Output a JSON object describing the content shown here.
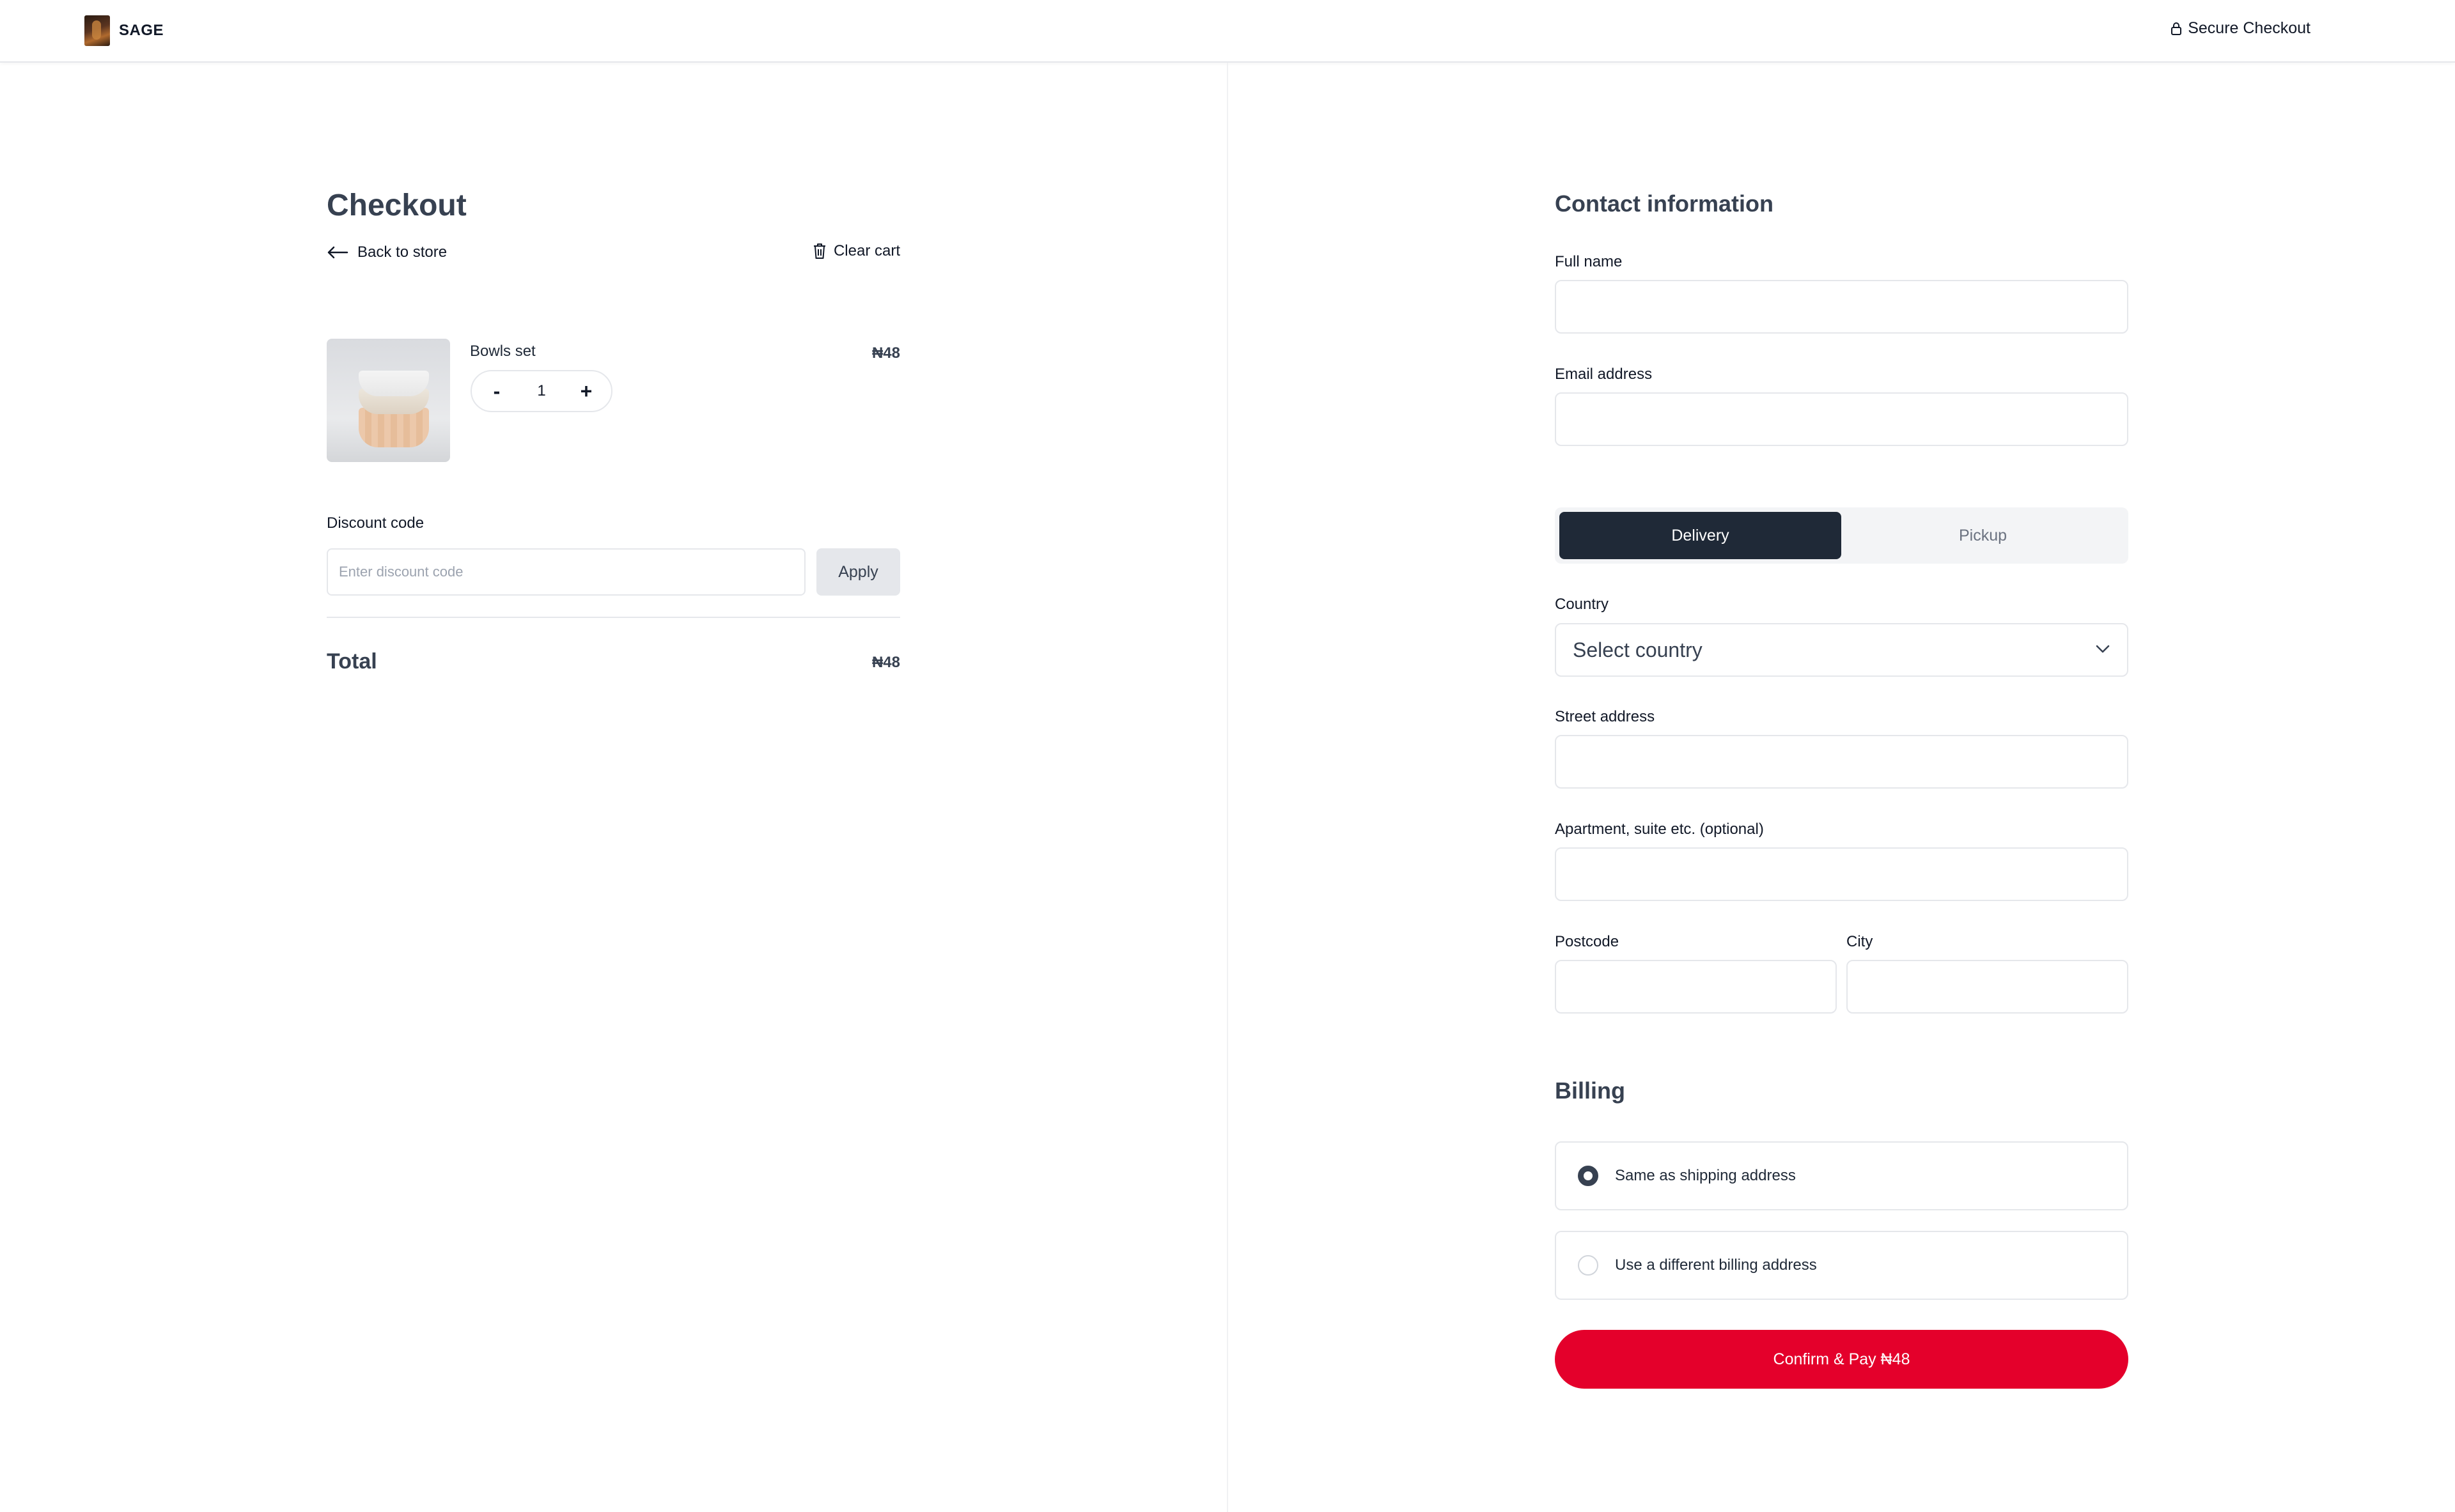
{
  "header": {
    "brand": "SAGE",
    "secure_label": "Secure Checkout"
  },
  "cart": {
    "title": "Checkout",
    "back_label": "Back to store",
    "clear_label": "Clear cart",
    "item": {
      "name": "Bowls set",
      "quantity": "1",
      "decrement": "-",
      "increment": "+",
      "price": "₦48"
    },
    "discount": {
      "label": "Discount code",
      "placeholder": "Enter discount code",
      "apply_label": "Apply"
    },
    "total_label": "Total",
    "total_value": "₦48"
  },
  "contact": {
    "title": "Contact information",
    "full_name_label": "Full name",
    "email_label": "Email address"
  },
  "shipping": {
    "tabs": [
      "Delivery",
      "Pickup"
    ],
    "country_label": "Country",
    "country_value": "Select country",
    "street_label": "Street address",
    "apartment_label": "Apartment, suite etc. (optional)",
    "postcode_label": "Postcode",
    "city_label": "City"
  },
  "billing": {
    "title": "Billing",
    "options": [
      "Same as shipping address",
      "Use a different billing address"
    ],
    "selected_index": 0
  },
  "pay_button": "Confirm & Pay ₦48",
  "colors": {
    "primary_dark": "#1f2937",
    "pay_red": "#e4002b",
    "border": "#e5e7eb"
  }
}
